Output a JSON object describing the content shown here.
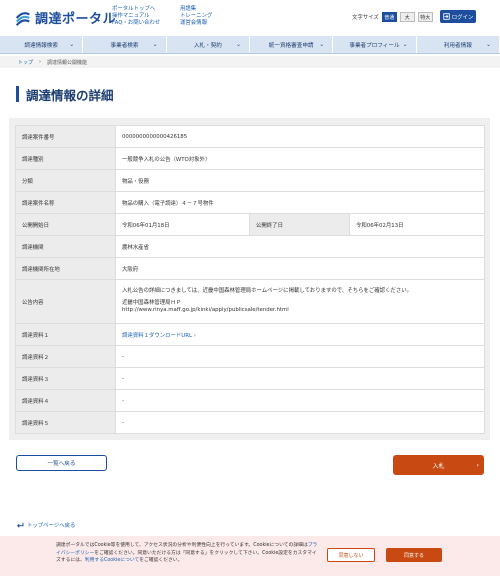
{
  "header": {
    "logo_text": "調達ポータル",
    "links_col1": [
      "ポータルトップへ",
      "操作マニュアル",
      "FAQ・お問い合わせ"
    ],
    "links_col2": [
      "用語集",
      "トレーニング",
      "運営会情報"
    ],
    "font_size_label": "文字サイズ",
    "font_sizes": [
      "普通",
      "大",
      "特大"
    ],
    "login_label": "ログイン"
  },
  "nav": [
    "調達情報検索",
    "事業者検索",
    "入札・契約",
    "統一資格審査申請",
    "事業者プロフィール",
    "利用者情報"
  ],
  "breadcrumb": {
    "home": "トップ",
    "current": "調達情報公開機能"
  },
  "page_title": "調達情報の詳細",
  "detail": {
    "case_number_label": "調達案件番号",
    "case_number": "0000000000000426185",
    "type_label": "調達種別",
    "type": "一般競争入札の公告（WTO対象外）",
    "category_label": "分類",
    "category": "物品・役務",
    "name_label": "調達案件名称",
    "name": "物品の購入（電子調達）４－７号物件",
    "start_label": "公開開始日",
    "start": "令和06年01月18日",
    "end_label": "公開終了日",
    "end": "令和06年02月13日",
    "org_label": "調達機関",
    "org": "農林水産省",
    "location_label": "調達機関所在地",
    "location": "大阪府",
    "content_label": "公告内容",
    "content_line1": "入札公告の詳細につきましては、近畿中国森林管理局ホームページに掲載しておりますので、そちらをご確認ください。",
    "content_line2": "近畿中国森林管理局ＨＰ",
    "content_line3": "http://www.rinya.maff.go.jp/kinki/apply/publicsale/tender.html",
    "doc1_label": "調達資料１",
    "doc1": "調達資料１ダウンロードURL",
    "doc2_label": "調達資料２",
    "doc2": "-",
    "doc3_label": "調達資料３",
    "doc3": "-",
    "doc4_label": "調達資料４",
    "doc4": "-",
    "doc5_label": "調達資料５",
    "doc5": "-"
  },
  "buttons": {
    "back": "一覧へ戻る",
    "bid": "入札"
  },
  "to_top": "トップページへ戻る",
  "cookie": {
    "text_a": "調達ポータルではCookie等を使用して、アクセス状況の分析や利便性向上を行っています。Cookieについての詳細は",
    "policy_link": "プライバシーポリシー",
    "text_b": "をご確認ください。同意いただける方は「同意する」をクリックして下さい。Cookie設定をカスタマイズするには、",
    "settings_link": "利用するCookieについて",
    "text_c": "をご確認ください。",
    "deny": "同意しない",
    "agree": "同意する"
  },
  "colors": {
    "brand": "#1d4e9e",
    "action": "#c84a12"
  }
}
